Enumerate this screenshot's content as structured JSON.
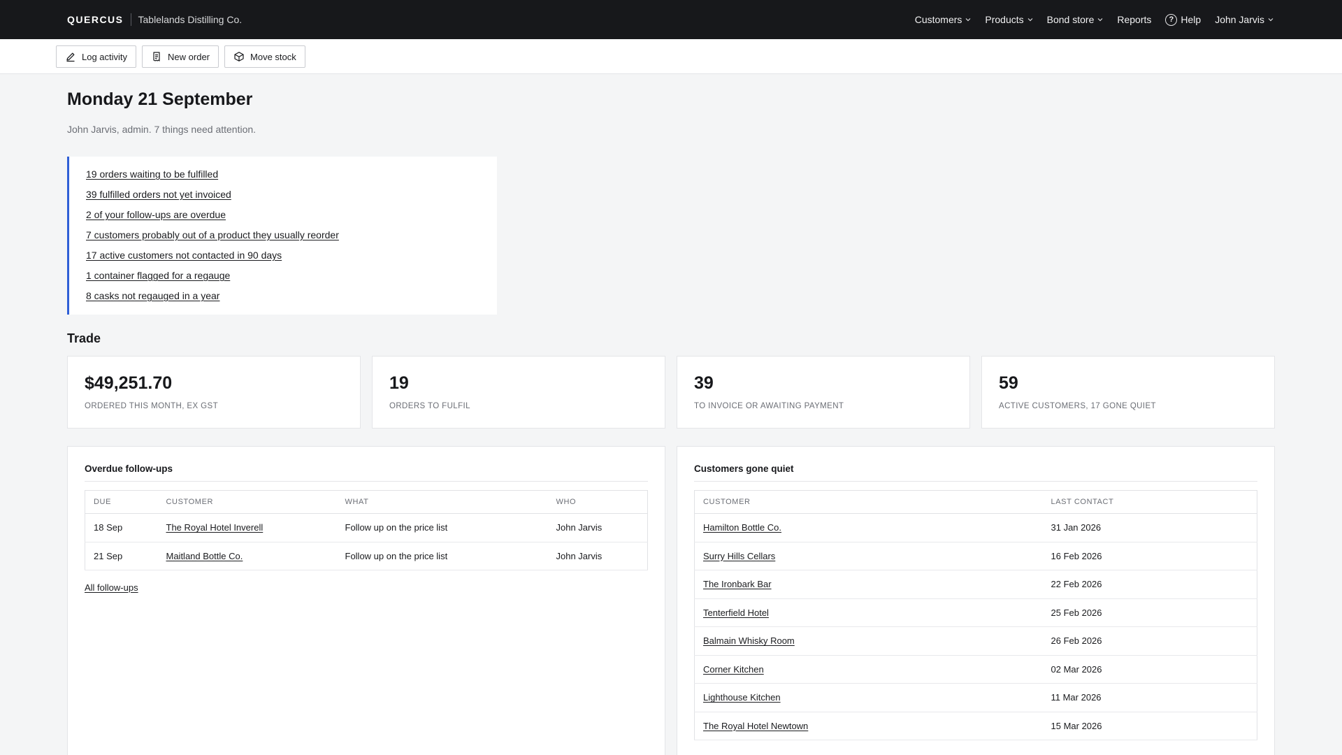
{
  "topbar": {
    "logo": "QUERCUS",
    "company": "Tablelands Distilling Co.",
    "nav": {
      "customers": "Customers",
      "products": "Products",
      "bond_store": "Bond store",
      "reports": "Reports",
      "help": "Help",
      "user": "John Jarvis"
    }
  },
  "actions": {
    "log_activity": "Log activity",
    "new_order": "New order",
    "move_stock": "Move stock"
  },
  "page": {
    "title": "Monday 21 September",
    "subtitle": "John Jarvis, admin. 7 things need attention."
  },
  "attention": [
    "19 orders waiting to be fulfilled",
    "39 fulfilled orders not yet invoiced",
    "2 of your follow-ups are overdue",
    "7 customers probably out of a product they usually reorder",
    "17 active customers not contacted in 90 days",
    "1 container flagged for a regauge",
    "8 casks not regauged in a year"
  ],
  "trade": {
    "title": "Trade",
    "stats": [
      {
        "value": "$49,251.70",
        "label": "Ordered this month, ex GST"
      },
      {
        "value": "19",
        "label": "Orders to fulfil"
      },
      {
        "value": "39",
        "label": "To invoice or awaiting payment"
      },
      {
        "value": "59",
        "label": "Active customers, 17 gone quiet"
      }
    ]
  },
  "followups": {
    "title": "Overdue follow-ups",
    "headers": {
      "due": "Due",
      "customer": "Customer",
      "what": "What",
      "who": "Who"
    },
    "rows": [
      {
        "due": "18 Sep",
        "customer": "The Royal Hotel Inverell",
        "what": "Follow up on the price list",
        "who": "John Jarvis"
      },
      {
        "due": "21 Sep",
        "customer": "Maitland Bottle Co.",
        "what": "Follow up on the price list",
        "who": "John Jarvis"
      }
    ],
    "link": "All follow-ups"
  },
  "quiet": {
    "title": "Customers gone quiet",
    "headers": {
      "customer": "Customer",
      "last_contact": "Last contact"
    },
    "rows": [
      {
        "customer": "Hamilton Bottle Co.",
        "last_contact": "31 Jan 2026"
      },
      {
        "customer": "Surry Hills Cellars",
        "last_contact": "16 Feb 2026"
      },
      {
        "customer": "The Ironbark Bar",
        "last_contact": "22 Feb 2026"
      },
      {
        "customer": "Tenterfield Hotel",
        "last_contact": "25 Feb 2026"
      },
      {
        "customer": "Balmain Whisky Room",
        "last_contact": "26 Feb 2026"
      },
      {
        "customer": "Corner Kitchen",
        "last_contact": "02 Mar 2026"
      },
      {
        "customer": "Lighthouse Kitchen",
        "last_contact": "11 Mar 2026"
      },
      {
        "customer": "The Royal Hotel Newtown",
        "last_contact": "15 Mar 2026"
      }
    ]
  }
}
